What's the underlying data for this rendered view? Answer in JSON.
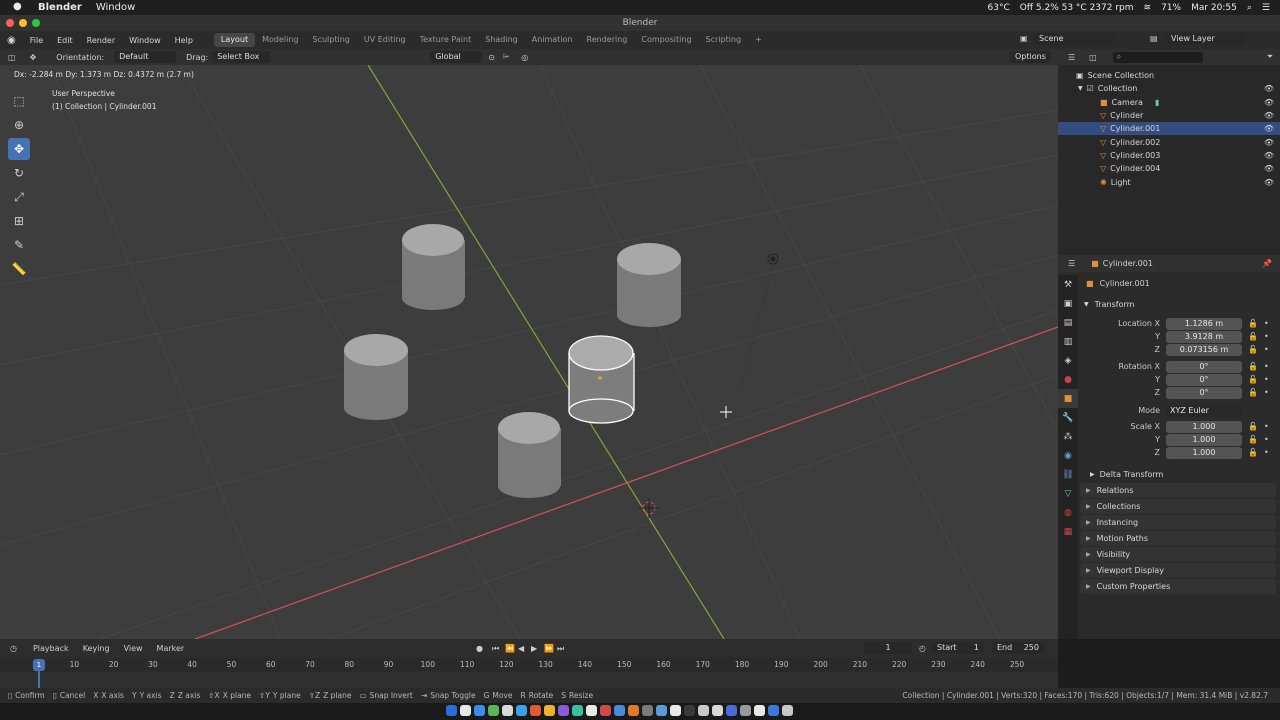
{
  "macbar": {
    "app": "Blender",
    "menu": [
      "Window"
    ],
    "status_items": [
      "Off 5.2% 53 °C 2372 rpm",
      "63°C",
      "71%",
      "Mar 20:55"
    ]
  },
  "window": {
    "title": "Blender"
  },
  "topmenu": {
    "items": [
      "File",
      "Edit",
      "Render",
      "Window",
      "Help"
    ],
    "workspaces": [
      "Layout",
      "Modeling",
      "Sculpting",
      "UV Editing",
      "Texture Paint",
      "Shading",
      "Animation",
      "Rendering",
      "Compositing",
      "Scripting"
    ],
    "active_workspace": "Layout",
    "add": "+",
    "scene": "Scene",
    "view_layer": "View Layer"
  },
  "header": {
    "orientation_label": "Orientation:",
    "orientation_value": "Default",
    "drag_label": "Drag:",
    "drag_value": "Select Box",
    "transform_space": "Global",
    "options": "Options"
  },
  "viewport": {
    "delta": "Dx: -2.284 m  Dy: 1.373 m  Dz: 0.4372 m (2.7 m)",
    "perspective": "User Perspective",
    "collection_info": "(1) Collection | Cylinder.001"
  },
  "outliner": {
    "root": "Scene Collection",
    "collection": "Collection",
    "items": [
      {
        "name": "Camera",
        "selected": false
      },
      {
        "name": "Cylinder",
        "selected": false
      },
      {
        "name": "Cylinder.001",
        "selected": true
      },
      {
        "name": "Cylinder.002",
        "selected": false
      },
      {
        "name": "Cylinder.003",
        "selected": false
      },
      {
        "name": "Cylinder.004",
        "selected": false
      },
      {
        "name": "Light",
        "selected": false
      }
    ]
  },
  "properties": {
    "object_name": "Cylinder.001",
    "object_field": "Cylinder.001",
    "transform_label": "Transform",
    "location": {
      "label": "Location X",
      "y": "Y",
      "z": "Z",
      "x_val": "1.1286 m",
      "y_val": "3.9128 m",
      "z_val": "0.073156 m"
    },
    "rotation": {
      "label": "Rotation X",
      "y": "Y",
      "z": "Z",
      "x_val": "0°",
      "y_val": "0°",
      "z_val": "0°"
    },
    "mode": {
      "label": "Mode",
      "value": "XYZ Euler"
    },
    "scale": {
      "label": "Scale X",
      "y": "Y",
      "z": "Z",
      "x_val": "1.000",
      "y_val": "1.000",
      "z_val": "1.000"
    },
    "delta_transform": "Delta Transform",
    "panels": [
      "Relations",
      "Collections",
      "Instancing",
      "Motion Paths",
      "Visibility",
      "Viewport Display",
      "Custom Properties"
    ]
  },
  "timeline": {
    "playback": "Playback",
    "keying": "Keying",
    "view": "View",
    "marker": "Marker",
    "current_frame": "1",
    "start_label": "Start",
    "start": "1",
    "end_label": "End",
    "end": "250",
    "ruler": [
      "1",
      "10",
      "20",
      "30",
      "40",
      "50",
      "60",
      "70",
      "80",
      "90",
      "100",
      "110",
      "120",
      "130",
      "140",
      "150",
      "160",
      "170",
      "180",
      "190",
      "200",
      "210",
      "220",
      "230",
      "240",
      "250"
    ]
  },
  "statusbar": {
    "keys": [
      "Confirm",
      "Cancel",
      "X axis",
      "Y axis",
      "Z axis",
      "X plane",
      "Y plane",
      "Z plane",
      "Snap Invert",
      "Snap Toggle",
      "Move",
      "Rotate",
      "Resize"
    ],
    "info": "Collection | Cylinder.001 | Verts:320 | Faces:170 | Tris:620 | Objects:1/7 | Mem: 31.4 MiB | v2.82.7"
  },
  "colors": {
    "accent": "#4772b3",
    "selected_row": "#334d80",
    "x_axis": "#d2505f",
    "y_axis": "#8aa33a"
  }
}
